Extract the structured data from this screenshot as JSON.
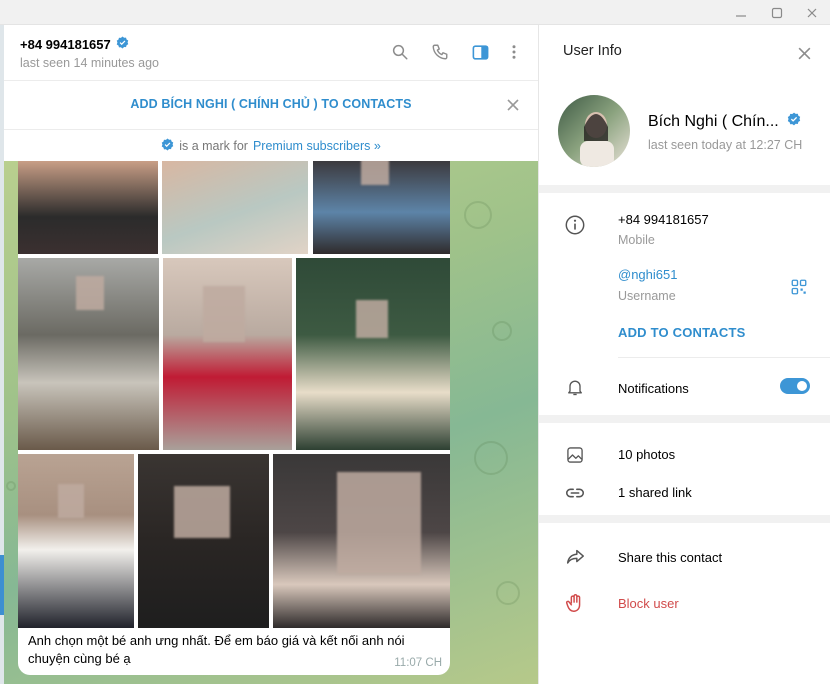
{
  "window": {
    "controls": [
      "minimize-icon",
      "maximize-icon",
      "close-icon"
    ]
  },
  "chat": {
    "peer_phone": "+84 994181657",
    "peer_last_seen": "last seen 14 minutes ago",
    "add_contact_banner": "ADD BÍCH NGHI ( CHÍNH CHỦ ) TO CONTACTS",
    "premium_note": "is a mark for",
    "premium_link": "Premium subscribers »",
    "message_caption": "Anh chọn một bé anh ưng nhất. Để em báo giá và kết nối anh nói chuyện cùng bé ạ",
    "message_time": "11:07 CH",
    "header_icons": [
      "search-icon",
      "phone-icon",
      "sidebar-toggle-icon",
      "more-vertical-icon"
    ]
  },
  "user_info": {
    "title": "User Info",
    "name": "Bích Nghi ( Chín...",
    "last_seen": "last seen today at 12:27 CH",
    "phone": "+84 994181657",
    "phone_label": "Mobile",
    "username": "@nghi651",
    "username_label": "Username",
    "add_to_contacts": "ADD TO CONTACTS",
    "notifications_label": "Notifications",
    "notifications_on": true,
    "photos": "10 photos",
    "shared_links": "1 shared link",
    "share_contact": "Share this contact",
    "block_user": "Block user"
  },
  "colors": {
    "accent": "#2f8dcd",
    "toggle": "#3d96d6",
    "danger": "#d14b4b",
    "verified": "#3d96d6"
  }
}
